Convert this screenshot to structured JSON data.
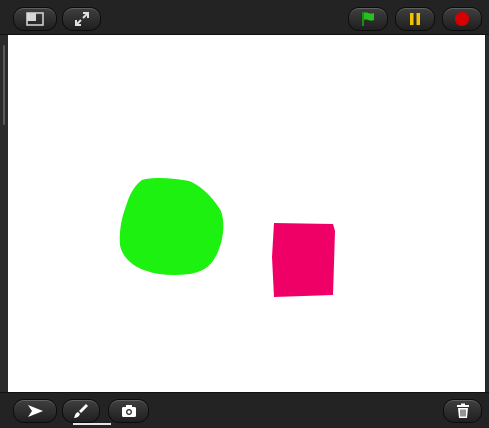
{
  "toolbar_top": {
    "left_buttons": [
      {
        "name": "layout-toggle-button",
        "icon": "stage-layout-icon"
      },
      {
        "name": "fullscreen-button",
        "icon": "expand-arrows-icon"
      }
    ],
    "right_buttons": [
      {
        "name": "green-flag-button",
        "icon": "green-flag-icon",
        "color": "#26c11f"
      },
      {
        "name": "pause-button",
        "icon": "pause-icon",
        "color": "#f4c200"
      },
      {
        "name": "stop-button",
        "icon": "red-circle-icon",
        "color": "#d60000"
      }
    ]
  },
  "stage": {
    "background": "#ffffff",
    "sprites": [
      {
        "name": "green-circle-sprite",
        "shape": "blob",
        "color": "#1cf10f"
      },
      {
        "name": "pink-rectangle-sprite",
        "shape": "rectangle",
        "color": "#ee0067"
      }
    ]
  },
  "toolbar_bottom": {
    "buttons": [
      {
        "name": "select-tool-button",
        "icon": "arrow-pointer-icon"
      },
      {
        "name": "paint-tool-button",
        "icon": "paintbrush-icon",
        "selected": true
      },
      {
        "name": "camera-button",
        "icon": "camera-icon"
      },
      {
        "name": "delete-button",
        "icon": "trash-icon"
      }
    ]
  }
}
